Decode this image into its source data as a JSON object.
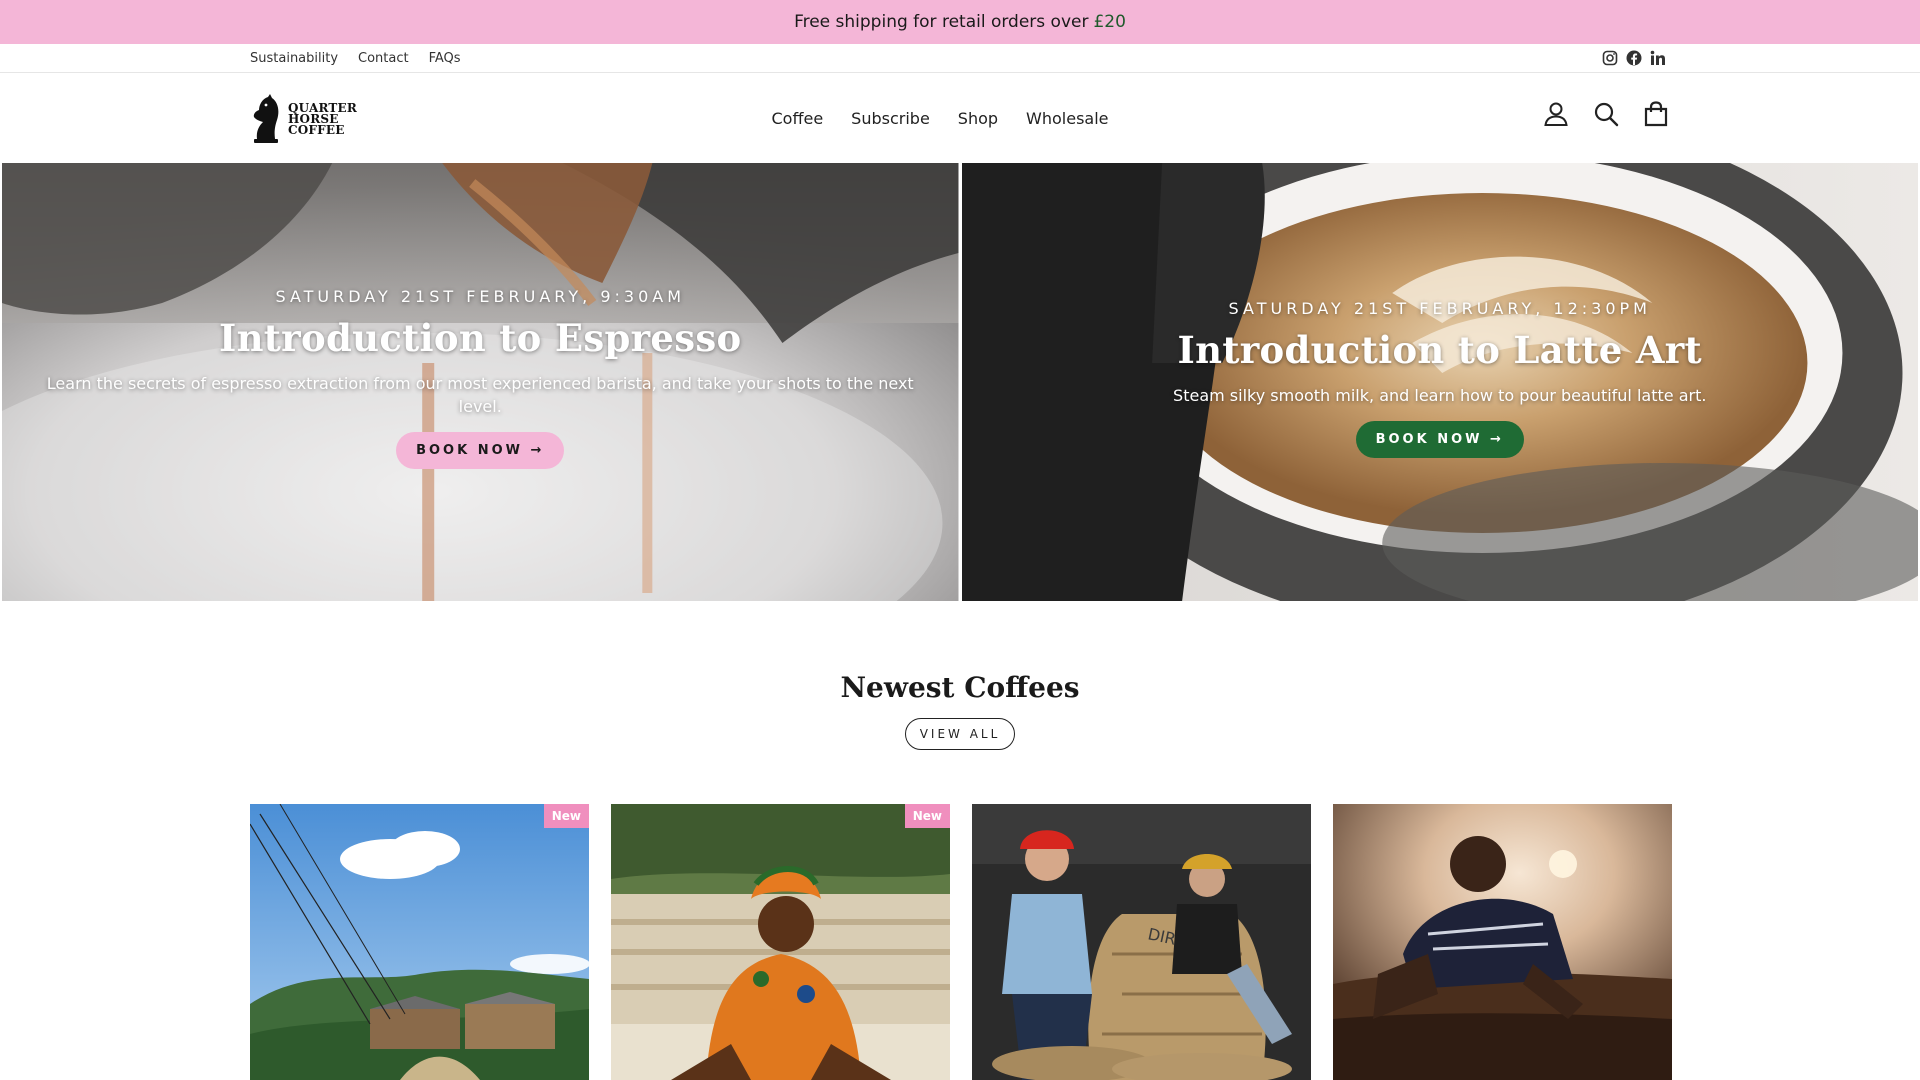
{
  "announcement": {
    "text": "Free shipping for retail orders over",
    "amount": "£20",
    "bg_color": "#f4b6d7",
    "amount_color": "#1f5a2c"
  },
  "utility": {
    "links": [
      "Sustainability",
      "Contact",
      "FAQs"
    ],
    "social_icons": [
      "instagram-icon",
      "facebook-icon",
      "linkedin-icon"
    ]
  },
  "header": {
    "logo_lines": [
      "QUARTER",
      "HORSE",
      "COFFEE"
    ],
    "nav": [
      "Coffee",
      "Subscribe",
      "Shop",
      "Wholesale"
    ],
    "icons": [
      "account-icon",
      "search-icon",
      "cart-icon"
    ]
  },
  "hero": {
    "left": {
      "date": "SATURDAY 21ST FEBRUARY, 9:30AM",
      "title": "Introduction to Espresso",
      "description": "Learn the secrets of espresso extraction from our most experienced barista, and take your shots to the next level.",
      "button": "BOOK NOW →",
      "button_color": "#f4b6d7"
    },
    "right": {
      "date": "SATURDAY 21ST FEBRUARY, 12:30PM",
      "title": "Introduction to Latte Art",
      "description": "Steam silky smooth milk, and learn how to pour beautiful latte art.",
      "button": "BOOK NOW →",
      "button_color": "#1f6b34"
    }
  },
  "newest": {
    "title": "Newest Coffees",
    "view_all": "VIEW ALL",
    "products": [
      {
        "badge": "New"
      },
      {
        "badge": "New"
      },
      {
        "badge": ""
      },
      {
        "badge": ""
      }
    ],
    "badge_color": "#f08fbe"
  }
}
